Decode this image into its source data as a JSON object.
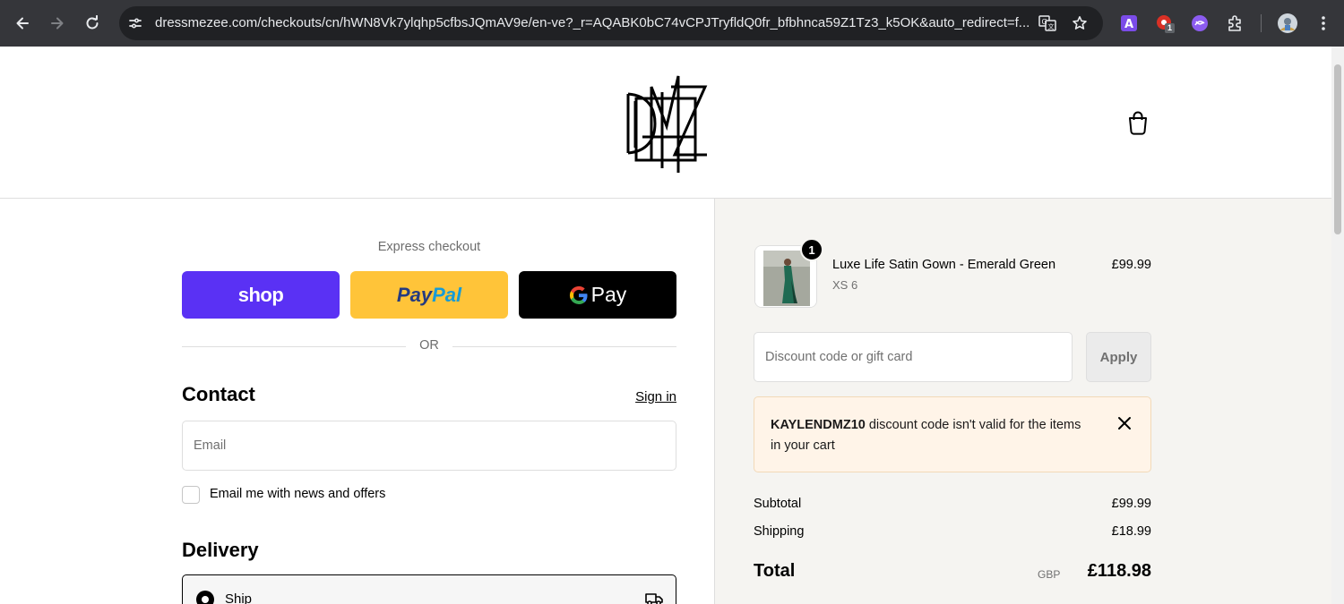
{
  "browser": {
    "url": "dressmezee.com/checkouts/cn/hWN8Vk7ylqhp5cfbsJQmAV9e/en-ve?_r=AQABK0bC74vCPJTryfldQ0fr_bfbhnca59Z1Tz3_k5OK&auto_redirect=f...",
    "extension_badge": "1",
    "icons": [
      "back-icon",
      "forward-icon",
      "reload-icon",
      "site-info-icon",
      "translate-icon",
      "star-icon",
      "extension-a-icon",
      "extension-red-icon",
      "extension-purple-icon",
      "extensions-puzzle-icon",
      "profile-avatar",
      "kebab-menu-icon"
    ]
  },
  "header": {
    "logo_text": "DMZ",
    "cart_icon": "shopping-bag-icon"
  },
  "express": {
    "label": "Express checkout",
    "shop_label": "shop",
    "paypal_part1": "Pay",
    "paypal_part2": "Pal",
    "gpay_label": "Pay",
    "or_text": "OR"
  },
  "contact": {
    "title": "Contact",
    "signin_label": "Sign in",
    "email_placeholder": "Email",
    "newsletter_label": "Email me with news and offers"
  },
  "delivery": {
    "title": "Delivery",
    "ship_label": "Ship",
    "ship_icon": "truck-icon"
  },
  "summary": {
    "product": {
      "name": "Luxe Life Satin Gown - Emerald Green",
      "variant": "XS 6",
      "price": "£99.99",
      "quantity": "1"
    },
    "discount_placeholder": "Discount code or gift card",
    "apply_label": "Apply",
    "alert_code": "KAYLENDMZ10",
    "alert_message": " discount code isn't valid for the items in your cart",
    "subtotal_label": "Subtotal",
    "subtotal_value": "£99.99",
    "shipping_label": "Shipping",
    "shipping_value": "£18.99",
    "total_label": "Total",
    "total_currency": "GBP",
    "total_value": "£118.98"
  },
  "colors": {
    "shop_purple": "#5a31f4",
    "paypal_yellow": "#ffc439",
    "alert_bg": "#fff4e8",
    "summary_bg": "#f5f4f1"
  }
}
